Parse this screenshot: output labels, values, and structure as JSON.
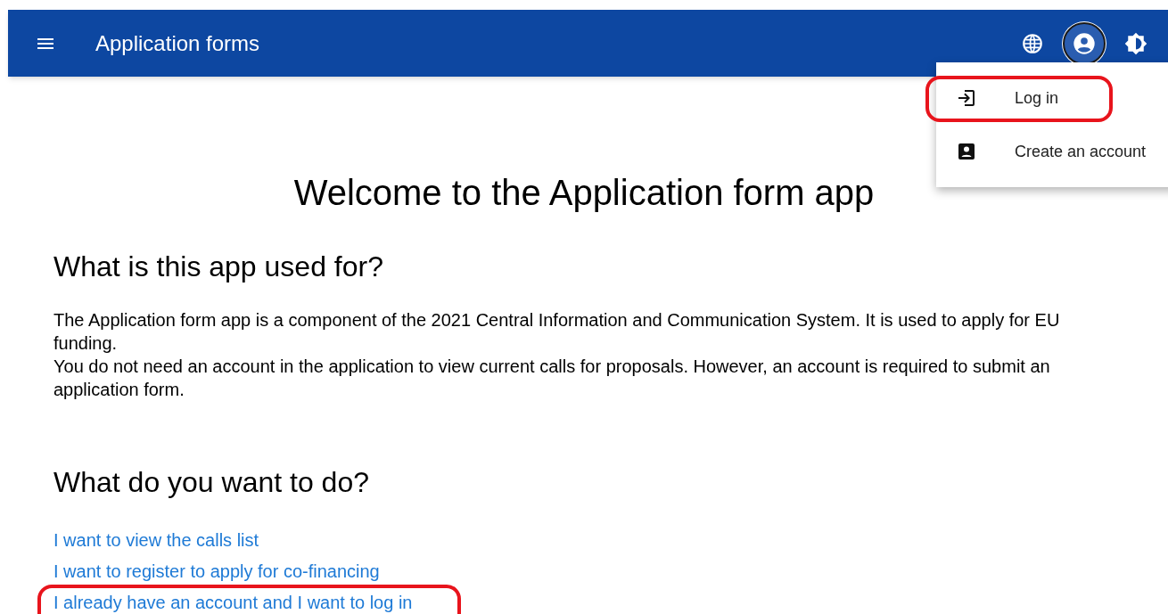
{
  "header": {
    "title": "Application forms",
    "actions": [
      {
        "kind": "language",
        "selected": false
      },
      {
        "kind": "account",
        "selected": true
      },
      {
        "kind": "theme",
        "selected": false
      }
    ]
  },
  "account_menu": {
    "items": [
      {
        "kind": "login",
        "label": "Log in",
        "highlighted": true
      },
      {
        "kind": "register",
        "label": "Create an account",
        "highlighted": false
      }
    ]
  },
  "main": {
    "title": "Welcome to the Application form app",
    "sections": [
      {
        "heading": "What is this app used for?",
        "paragraphs": [
          "The Application form app is a component of the 2021 Central Information and Communication System. It is used to apply for EU funding.",
          "You do not need an account in the application to view current calls for proposals. However, an account is required to submit an application form."
        ]
      },
      {
        "heading": "What do you want to do?",
        "links": [
          {
            "label": "I want to view the calls list",
            "highlighted": false
          },
          {
            "label": "I want to register to apply for co-financing",
            "highlighted": false
          },
          {
            "label": "I already have an account and I want to log in",
            "highlighted": true
          }
        ]
      }
    ]
  }
}
